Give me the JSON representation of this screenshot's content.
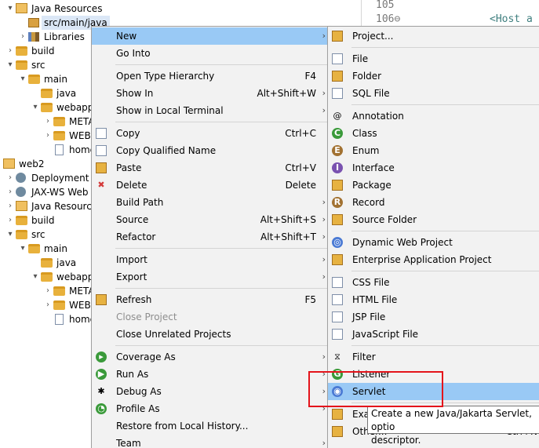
{
  "editor": {
    "lines": [
      {
        "num": "105",
        "code": ""
      },
      {
        "num": "106⊖",
        "code": "<Host a"
      }
    ]
  },
  "explorer": {
    "rows": [
      {
        "label": "Java Resources",
        "indent": 0,
        "twisty": "▾",
        "icon": "project"
      },
      {
        "label": "src/main/java",
        "indent": 1,
        "twisty": "",
        "icon": "pkg",
        "selected": true
      },
      {
        "label": "Libraries",
        "indent": 1,
        "twisty": "›",
        "icon": "lib"
      },
      {
        "label": "build",
        "indent": 0,
        "twisty": "›",
        "icon": "folder"
      },
      {
        "label": "src",
        "indent": 0,
        "twisty": "▾",
        "icon": "folder"
      },
      {
        "label": "main",
        "indent": 1,
        "twisty": "▾",
        "icon": "folder"
      },
      {
        "label": "java",
        "indent": 2,
        "twisty": "",
        "icon": "folder"
      },
      {
        "label": "webapp",
        "indent": 2,
        "twisty": "▾",
        "icon": "folder"
      },
      {
        "label": "META",
        "indent": 3,
        "twisty": "›",
        "icon": "folder"
      },
      {
        "label": "WEB-",
        "indent": 3,
        "twisty": "›",
        "icon": "folder"
      },
      {
        "label": "home",
        "indent": 3,
        "twisty": "",
        "icon": "file"
      },
      {
        "label": "web2",
        "indent": -1,
        "twisty": "",
        "icon": "project"
      },
      {
        "label": "Deployment D",
        "indent": 0,
        "twisty": "›",
        "icon": "gear"
      },
      {
        "label": "JAX-WS Web S",
        "indent": 0,
        "twisty": "›",
        "icon": "gear"
      },
      {
        "label": "Java Resources",
        "indent": 0,
        "twisty": "›",
        "icon": "project"
      },
      {
        "label": "build",
        "indent": 0,
        "twisty": "›",
        "icon": "folder"
      },
      {
        "label": "src",
        "indent": 0,
        "twisty": "▾",
        "icon": "folder"
      },
      {
        "label": "main",
        "indent": 1,
        "twisty": "▾",
        "icon": "folder"
      },
      {
        "label": "java",
        "indent": 2,
        "twisty": "",
        "icon": "folder"
      },
      {
        "label": "webapp",
        "indent": 2,
        "twisty": "▾",
        "icon": "folder"
      },
      {
        "label": "META",
        "indent": 3,
        "twisty": "›",
        "icon": "folder"
      },
      {
        "label": "WEB-",
        "indent": 3,
        "twisty": "›",
        "icon": "folder"
      },
      {
        "label": "home",
        "indent": 3,
        "twisty": "",
        "icon": "file"
      }
    ]
  },
  "context_menu": {
    "items": [
      {
        "type": "item",
        "label": "New",
        "shortcut": "",
        "submenu": true,
        "highlighted": true
      },
      {
        "type": "item",
        "label": "Go Into",
        "shortcut": ""
      },
      {
        "type": "sep"
      },
      {
        "type": "item",
        "label": "Open Type Hierarchy",
        "shortcut": "F4"
      },
      {
        "type": "item",
        "label": "Show In",
        "shortcut": "Alt+Shift+W",
        "submenu": true
      },
      {
        "type": "item",
        "label": "Show in Local Terminal",
        "shortcut": "",
        "submenu": true
      },
      {
        "type": "sep"
      },
      {
        "type": "item",
        "label": "Copy",
        "shortcut": "Ctrl+C",
        "icon": "copy"
      },
      {
        "type": "item",
        "label": "Copy Qualified Name",
        "shortcut": "",
        "icon": "copy"
      },
      {
        "type": "item",
        "label": "Paste",
        "shortcut": "Ctrl+V",
        "icon": "paste"
      },
      {
        "type": "item",
        "label": "Delete",
        "shortcut": "Delete",
        "icon": "delete"
      },
      {
        "type": "item",
        "label": "Build Path",
        "shortcut": "",
        "submenu": true
      },
      {
        "type": "item",
        "label": "Source",
        "shortcut": "Alt+Shift+S",
        "submenu": true
      },
      {
        "type": "item",
        "label": "Refactor",
        "shortcut": "Alt+Shift+T",
        "submenu": true
      },
      {
        "type": "sep"
      },
      {
        "type": "item",
        "label": "Import",
        "shortcut": "",
        "submenu": true
      },
      {
        "type": "item",
        "label": "Export",
        "shortcut": "",
        "submenu": true
      },
      {
        "type": "sep"
      },
      {
        "type": "item",
        "label": "Refresh",
        "shortcut": "F5",
        "icon": "refresh"
      },
      {
        "type": "item",
        "label": "Close Project",
        "shortcut": "",
        "disabled": true
      },
      {
        "type": "item",
        "label": "Close Unrelated Projects",
        "shortcut": ""
      },
      {
        "type": "sep"
      },
      {
        "type": "item",
        "label": "Coverage As",
        "shortcut": "",
        "submenu": true,
        "icon": "coverage"
      },
      {
        "type": "item",
        "label": "Run As",
        "shortcut": "",
        "submenu": true,
        "icon": "run"
      },
      {
        "type": "item",
        "label": "Debug As",
        "shortcut": "",
        "submenu": true,
        "icon": "debug"
      },
      {
        "type": "item",
        "label": "Profile As",
        "shortcut": "",
        "submenu": true,
        "icon": "profile"
      },
      {
        "type": "item",
        "label": "Restore from Local History...",
        "shortcut": ""
      },
      {
        "type": "item",
        "label": "Team",
        "shortcut": "",
        "submenu": true
      }
    ]
  },
  "new_submenu": {
    "items": [
      {
        "type": "item",
        "label": "Project...",
        "icon": "project"
      },
      {
        "type": "sep"
      },
      {
        "type": "item",
        "label": "File",
        "icon": "file"
      },
      {
        "type": "item",
        "label": "Folder",
        "icon": "folder"
      },
      {
        "type": "item",
        "label": "SQL File",
        "icon": "sql"
      },
      {
        "type": "sep"
      },
      {
        "type": "item",
        "label": "Annotation",
        "icon": "annotation"
      },
      {
        "type": "item",
        "label": "Class",
        "icon": "class"
      },
      {
        "type": "item",
        "label": "Enum",
        "icon": "enum"
      },
      {
        "type": "item",
        "label": "Interface",
        "icon": "interface"
      },
      {
        "type": "item",
        "label": "Package",
        "icon": "package"
      },
      {
        "type": "item",
        "label": "Record",
        "icon": "record"
      },
      {
        "type": "item",
        "label": "Source Folder",
        "icon": "source-folder"
      },
      {
        "type": "sep"
      },
      {
        "type": "item",
        "label": "Dynamic Web Project",
        "icon": "web-project"
      },
      {
        "type": "item",
        "label": "Enterprise Application Project",
        "icon": "ear-project"
      },
      {
        "type": "sep"
      },
      {
        "type": "item",
        "label": "CSS File",
        "icon": "css"
      },
      {
        "type": "item",
        "label": "HTML File",
        "icon": "html"
      },
      {
        "type": "item",
        "label": "JSP File",
        "icon": "jsp"
      },
      {
        "type": "item",
        "label": "JavaScript File",
        "icon": "js"
      },
      {
        "type": "sep"
      },
      {
        "type": "item",
        "label": "Filter",
        "icon": "filter"
      },
      {
        "type": "item",
        "label": "Listener",
        "icon": "listener"
      },
      {
        "type": "item",
        "label": "Servlet",
        "icon": "servlet",
        "highlighted": true
      },
      {
        "type": "sep"
      },
      {
        "type": "item",
        "label": "Exa",
        "icon": "example"
      },
      {
        "type": "item",
        "label": "Other...",
        "shortcut": "Ctrl+N",
        "icon": "other"
      }
    ]
  },
  "tooltip": {
    "line1": "Create a new Java/Jakarta Servlet, optio",
    "line2": "descriptor."
  }
}
